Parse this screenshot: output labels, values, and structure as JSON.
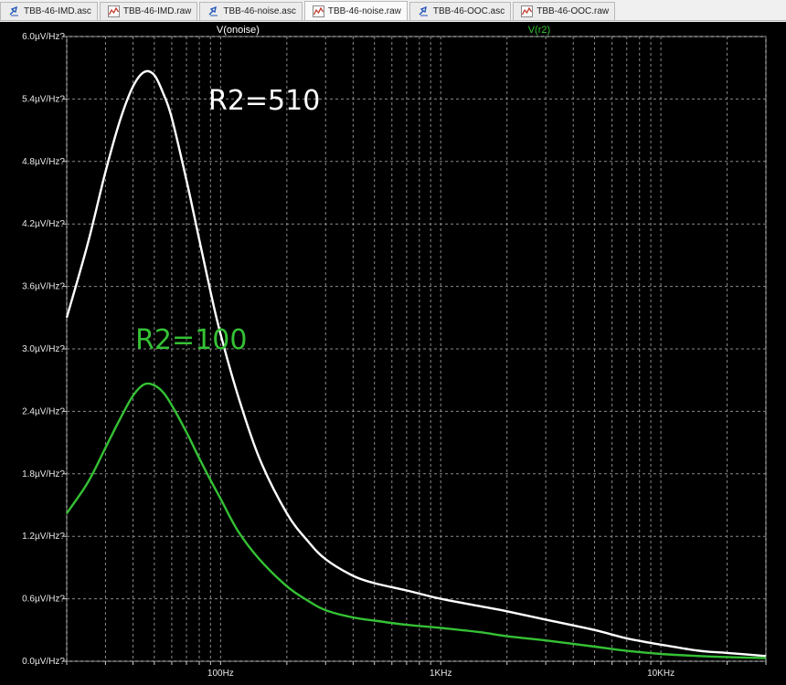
{
  "tabs": [
    {
      "label": "TBB-46-IMD.asc",
      "icon": "schematic-icon",
      "active": false
    },
    {
      "label": "TBB-46-IMD.raw",
      "icon": "waveform-icon",
      "active": false
    },
    {
      "label": "TBB-46-noise.asc",
      "icon": "schematic-icon",
      "active": false
    },
    {
      "label": "TBB-46-noise.raw",
      "icon": "waveform-icon",
      "active": true
    },
    {
      "label": "TBB-46-OOC.asc",
      "icon": "schematic-icon",
      "active": false
    },
    {
      "label": "TBB-46-OOC.raw",
      "icon": "waveform-icon",
      "active": false
    }
  ],
  "colors": {
    "background": "#000000",
    "grid": "#8a8a8a",
    "trace_onoise": "#ffffff",
    "trace_r2": "#35c135",
    "annotation_510": "#ffffff",
    "annotation_100": "#35c135"
  },
  "chart_data": {
    "type": "line",
    "x_scale": "log",
    "xlim": [
      20,
      30000
    ],
    "ylim": [
      0,
      6.0
    ],
    "y_ticks": [
      {
        "value": 0.0,
        "label": "0.0µV/Hz?"
      },
      {
        "value": 0.6,
        "label": "0.6µV/Hz?"
      },
      {
        "value": 1.2,
        "label": "1.2µV/Hz?"
      },
      {
        "value": 1.8,
        "label": "1.8µV/Hz?"
      },
      {
        "value": 2.4,
        "label": "2.4µV/Hz?"
      },
      {
        "value": 3.0,
        "label": "3.0µV/Hz?"
      },
      {
        "value": 3.6,
        "label": "3.6µV/Hz?"
      },
      {
        "value": 4.2,
        "label": "4.2µV/Hz?"
      },
      {
        "value": 4.8,
        "label": "4.8µV/Hz?"
      },
      {
        "value": 5.4,
        "label": "5.4µV/Hz?"
      },
      {
        "value": 6.0,
        "label": "6.0µV/Hz?"
      }
    ],
    "x_ticks": [
      {
        "value": 100,
        "label": "100Hz"
      },
      {
        "value": 1000,
        "label": "1KHz"
      },
      {
        "value": 10000,
        "label": "10KHz"
      }
    ],
    "grid": true,
    "series": [
      {
        "name": "V(onoise)",
        "color": "#ffffff",
        "x": [
          20,
          25,
          30,
          35,
          40,
          45,
          50,
          55,
          60,
          70,
          80,
          90,
          100,
          120,
          150,
          200,
          250,
          300,
          400,
          500,
          700,
          1000,
          1500,
          2000,
          3000,
          5000,
          7000,
          10000,
          15000,
          20000,
          30000
        ],
        "y": [
          3.3,
          4.02,
          4.7,
          5.2,
          5.52,
          5.66,
          5.63,
          5.45,
          5.22,
          4.62,
          4.05,
          3.55,
          3.14,
          2.55,
          1.95,
          1.42,
          1.15,
          0.98,
          0.82,
          0.75,
          0.68,
          0.6,
          0.53,
          0.48,
          0.4,
          0.3,
          0.22,
          0.16,
          0.1,
          0.08,
          0.05
        ]
      },
      {
        "name": "V(r2)",
        "color": "#35c135",
        "x": [
          20,
          25,
          30,
          35,
          40,
          45,
          50,
          55,
          60,
          70,
          80,
          90,
          100,
          120,
          150,
          200,
          250,
          300,
          400,
          500,
          700,
          1000,
          1500,
          2000,
          3000,
          5000,
          7000,
          10000,
          15000,
          20000,
          30000
        ],
        "y": [
          1.42,
          1.72,
          2.05,
          2.33,
          2.55,
          2.66,
          2.65,
          2.58,
          2.46,
          2.2,
          1.95,
          1.74,
          1.56,
          1.25,
          0.98,
          0.72,
          0.58,
          0.49,
          0.42,
          0.39,
          0.35,
          0.32,
          0.28,
          0.24,
          0.2,
          0.14,
          0.1,
          0.07,
          0.05,
          0.04,
          0.03
        ]
      }
    ],
    "annotations": [
      {
        "text": "R2=510",
        "series": "V(onoise)"
      },
      {
        "text": "R2=100",
        "series": "V(r2)"
      }
    ]
  }
}
